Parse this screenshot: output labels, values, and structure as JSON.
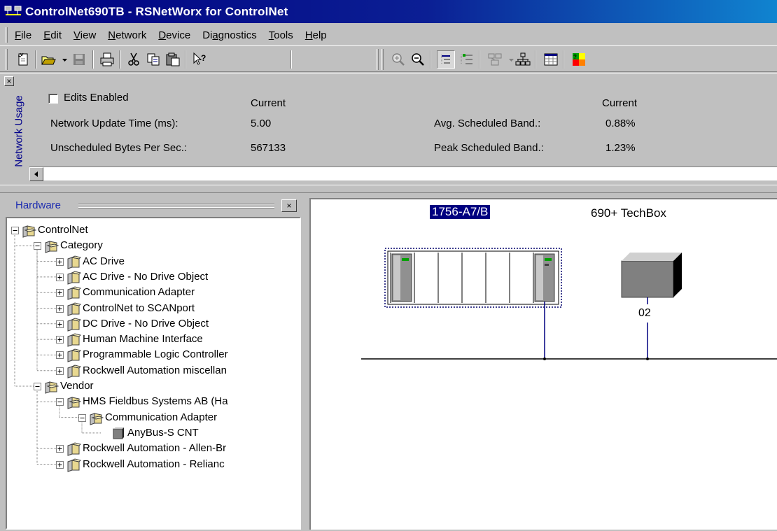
{
  "window": {
    "title": "ControlNet690TB - RSNetWorx for ControlNet",
    "title_color": "#000080"
  },
  "menu": [
    {
      "pre": "",
      "key": "F",
      "post": "ile"
    },
    {
      "pre": "",
      "key": "E",
      "post": "dit"
    },
    {
      "pre": "",
      "key": "V",
      "post": "iew"
    },
    {
      "pre": "",
      "key": "N",
      "post": "etwork"
    },
    {
      "pre": "",
      "key": "D",
      "post": "evice"
    },
    {
      "pre": "Di",
      "key": "a",
      "post": "gnostics"
    },
    {
      "pre": "",
      "key": "T",
      "post": "ools"
    },
    {
      "pre": "",
      "key": "H",
      "post": "elp"
    }
  ],
  "toolbar": {
    "icons": [
      "new-icon",
      "open-icon",
      "save-icon",
      "print-icon",
      "cut-icon",
      "copy-icon",
      "paste-icon",
      "help-pointer-icon",
      "zoom-in-icon",
      "zoom-out-icon",
      "single-pass-browse-icon",
      "continuous-browse-icon",
      "device-properties-icon",
      "network-view-icon",
      "spreadsheet-icon",
      "edits-enabled-icon"
    ]
  },
  "network_usage": {
    "panel_title": "Network Usage",
    "edits_enabled": "Edits Enabled",
    "edits_checked": false,
    "current_header_left": "Current",
    "current_header_right": "Current",
    "update_time_label": "Network Update Time (ms):",
    "update_time_value": "5.00",
    "unscheduled_label": "Unscheduled Bytes Per Sec.:",
    "unscheduled_value": "567133",
    "avg_label": "Avg. Scheduled Band.:",
    "avg_value": "0.88%",
    "peak_label": "Peak Scheduled Band.:",
    "peak_value": "1.23%"
  },
  "hardware": {
    "title": "Hardware",
    "tree": [
      {
        "label": "ControlNet",
        "level": 0,
        "expander": "minus",
        "icon": "folder-open"
      },
      {
        "label": "Category",
        "level": 1,
        "expander": "minus",
        "icon": "folder-open"
      },
      {
        "label": "AC Drive",
        "level": 2,
        "expander": "plus",
        "icon": "folder-closed"
      },
      {
        "label": "AC Drive - No Drive Object",
        "level": 2,
        "expander": "plus",
        "icon": "folder-closed"
      },
      {
        "label": "Communication Adapter",
        "level": 2,
        "expander": "plus",
        "icon": "folder-closed"
      },
      {
        "label": "ControlNet to SCANport",
        "level": 2,
        "expander": "plus",
        "icon": "folder-closed"
      },
      {
        "label": "DC Drive - No Drive Object",
        "level": 2,
        "expander": "plus",
        "icon": "folder-closed"
      },
      {
        "label": "Human Machine Interface",
        "level": 2,
        "expander": "plus",
        "icon": "folder-closed"
      },
      {
        "label": "Programmable Logic Controller",
        "level": 2,
        "expander": "plus",
        "icon": "folder-closed"
      },
      {
        "label": "Rockwell Automation miscellan",
        "level": 2,
        "expander": "plus",
        "icon": "folder-closed"
      },
      {
        "label": "Vendor",
        "level": 1,
        "expander": "minus",
        "icon": "folder-open"
      },
      {
        "label": "HMS Fieldbus Systems AB (Ha",
        "level": 2,
        "expander": "minus",
        "icon": "folder-open"
      },
      {
        "label": "Communication Adapter",
        "level": 3,
        "expander": "minus",
        "icon": "folder-open"
      },
      {
        "label": "AnyBus-S CNT",
        "level": 4,
        "expander": "none",
        "icon": "device"
      },
      {
        "label": "Rockwell Automation - Allen-Br",
        "level": 2,
        "expander": "plus",
        "icon": "folder-closed"
      },
      {
        "label": "Rockwell Automation - Relianc",
        "level": 2,
        "expander": "plus",
        "icon": "folder-closed"
      }
    ]
  },
  "network": {
    "devices": [
      {
        "name": "1756-A7/B",
        "selected": true,
        "kind": "chassis"
      },
      {
        "name": "690+ TechBox",
        "selected": false,
        "kind": "box",
        "node": "02"
      }
    ]
  }
}
